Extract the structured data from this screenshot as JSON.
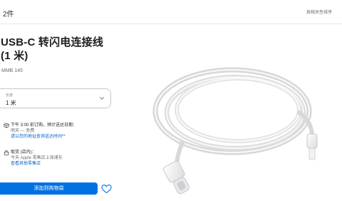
{
  "header": {
    "breadcrumb": "2件",
    "sort_label": "按相关性排序"
  },
  "product": {
    "title_line1": "USB-C 转闪电连接线",
    "title_line2": "(1 米)",
    "sku": "MMB 145"
  },
  "length_select": {
    "label": "长度",
    "value": "1 米"
  },
  "shipping": {
    "line1": "下午 3:00 前订购，预计送达日期：",
    "line2": "明天 — 免费",
    "line3": "请以您的地址查询送达时间**"
  },
  "pickup": {
    "line1": "取货 (店内)：",
    "line2": "今天 Apple 零售店上海浦东",
    "line3": "查看其他零售店"
  },
  "actions": {
    "add_to_bag": "添加到购物袋"
  },
  "icons": {
    "chevron": "chevron-down-icon",
    "shipping": "shipping-box-icon",
    "pickup": "store-icon",
    "favorite": "heart-icon"
  },
  "colors": {
    "accent": "#0071e3",
    "link": "#0066cc"
  }
}
